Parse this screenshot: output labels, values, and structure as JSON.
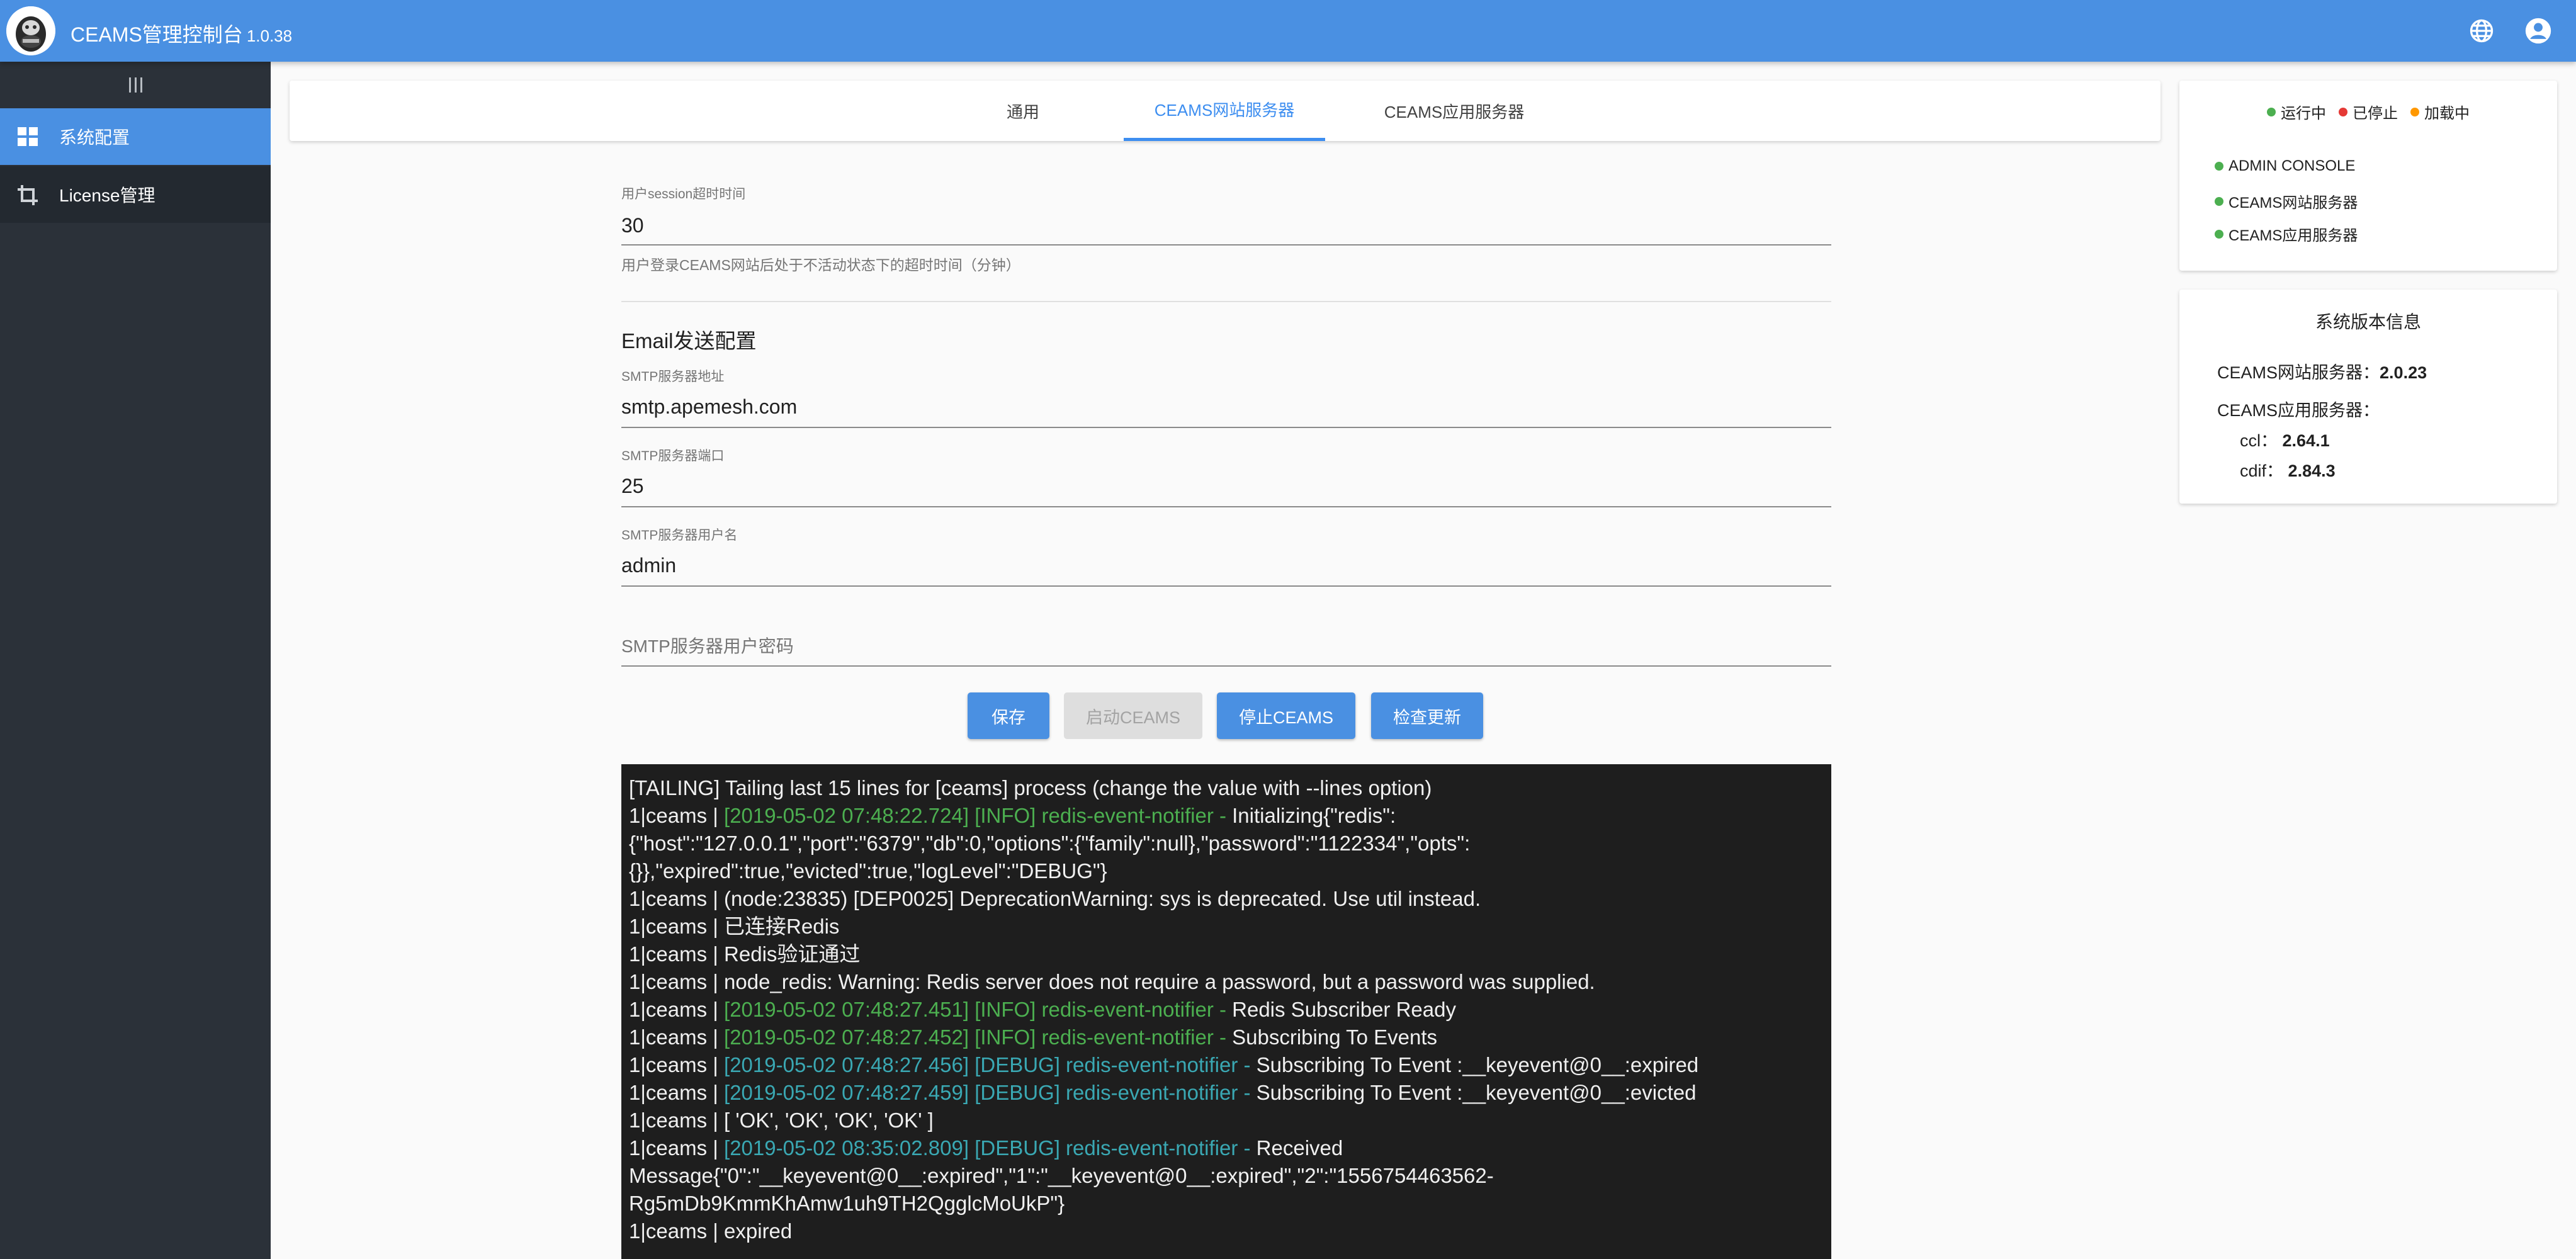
{
  "header": {
    "title": "CEAMS管理控制台",
    "version": "1.0.38",
    "icons": [
      "logo-avatar",
      "globe-icon",
      "account-icon"
    ]
  },
  "sidebar": {
    "toggle_icon": "menu-toggle-icon",
    "items": [
      {
        "label": "系统配置",
        "icon": "dashboard-icon",
        "active": true
      },
      {
        "label": "License管理",
        "icon": "crop-icon",
        "active": false
      }
    ]
  },
  "tabs": [
    {
      "label": "通用",
      "active": false
    },
    {
      "label": "CEAMS网站服务器",
      "active": true
    },
    {
      "label": "CEAMS应用服务器",
      "active": false
    }
  ],
  "form": {
    "session": {
      "label": "用户session超时时间",
      "value": "30",
      "hint": "用户登录CEAMS网站后处于不活动状态下的超时时间（分钟）"
    },
    "email_section_title": "Email发送配置",
    "smtp_host": {
      "label": "SMTP服务器地址",
      "value": "smtp.apemesh.com"
    },
    "smtp_port": {
      "label": "SMTP服务器端口",
      "value": "25"
    },
    "smtp_user": {
      "label": "SMTP服务器用户名",
      "value": "admin"
    },
    "smtp_password": {
      "placeholder": "SMTP服务器用户密码",
      "value": ""
    }
  },
  "buttons": {
    "save": "保存",
    "start": "启动CEAMS",
    "stop": "停止CEAMS",
    "check_update": "检查更新"
  },
  "console": {
    "lines": [
      {
        "parts": [
          {
            "t": "[TAILING] Tailing last 15 lines for [ceams] process (change the value with --lines option)",
            "c": ""
          }
        ]
      },
      {
        "parts": [
          {
            "t": "1|ceams | ",
            "c": ""
          },
          {
            "t": "[2019-05-02 07:48:22.724] [INFO] redis-event-notifier - ",
            "c": "info"
          },
          {
            "t": "Initializing{\"redis\":{\"host\":\"127.0.0.1\",\"port\":\"6379\",\"db\":0,\"options\":{\"family\":null},\"password\":\"1122334\",\"opts\":{}},\"expired\":true,\"evicted\":true,\"logLevel\":\"DEBUG\"}",
            "c": ""
          }
        ]
      },
      {
        "parts": [
          {
            "t": "1|ceams | (node:23835) [DEP0025] DeprecationWarning: sys is deprecated. Use util instead.",
            "c": ""
          }
        ]
      },
      {
        "parts": [
          {
            "t": "1|ceams | 已连接Redis",
            "c": ""
          }
        ]
      },
      {
        "parts": [
          {
            "t": "1|ceams | Redis验证通过",
            "c": ""
          }
        ]
      },
      {
        "parts": [
          {
            "t": "1|ceams | node_redis: Warning: Redis server does not require a password, but a password was supplied.",
            "c": ""
          }
        ]
      },
      {
        "parts": [
          {
            "t": "1|ceams | ",
            "c": ""
          },
          {
            "t": "[2019-05-02 07:48:27.451] [INFO] redis-event-notifier - ",
            "c": "info"
          },
          {
            "t": "Redis Subscriber Ready",
            "c": ""
          }
        ]
      },
      {
        "parts": [
          {
            "t": "1|ceams | ",
            "c": ""
          },
          {
            "t": "[2019-05-02 07:48:27.452] [INFO] redis-event-notifier - ",
            "c": "info"
          },
          {
            "t": "Subscribing To Events",
            "c": ""
          }
        ]
      },
      {
        "parts": [
          {
            "t": "1|ceams | ",
            "c": ""
          },
          {
            "t": "[2019-05-02 07:48:27.456] [DEBUG] redis-event-notifier - ",
            "c": "debug"
          },
          {
            "t": "Subscribing To Event :__keyevent@0__:expired",
            "c": ""
          }
        ]
      },
      {
        "parts": [
          {
            "t": "1|ceams | ",
            "c": ""
          },
          {
            "t": "[2019-05-02 07:48:27.459] [DEBUG] redis-event-notifier - ",
            "c": "debug"
          },
          {
            "t": "Subscribing To Event :__keyevent@0__:evicted",
            "c": ""
          }
        ]
      },
      {
        "parts": [
          {
            "t": "1|ceams | [ 'OK', 'OK', 'OK', 'OK' ]",
            "c": ""
          }
        ]
      },
      {
        "parts": [
          {
            "t": "1|ceams | ",
            "c": ""
          },
          {
            "t": "[2019-05-02 08:35:02.809] [DEBUG] redis-event-notifier - ",
            "c": "debug"
          },
          {
            "t": "Received Message{\"0\":\"__keyevent@0__:expired\",\"1\":\"__keyevent@0__:expired\",\"2\":\"1556754463562-Rg5mDb9KmmKhAmw1uh9TH2QgglcMoUkP\"}",
            "c": ""
          }
        ]
      },
      {
        "parts": [
          {
            "t": "1|ceams | expired",
            "c": ""
          }
        ]
      }
    ],
    "colors": {
      "info": "#4caf50",
      "debug": "#3aa8b3",
      "text": "#f0f0f0",
      "background": "#1e1e1e"
    }
  },
  "status_panel": {
    "legend": [
      {
        "label": "运行中",
        "color": "#4caf50"
      },
      {
        "label": "已停止",
        "color": "#e53935"
      },
      {
        "label": "加载中",
        "color": "#ff9800"
      }
    ],
    "services": [
      {
        "name": "ADMIN CONSOLE",
        "status_color": "#4caf50"
      },
      {
        "name": "CEAMS网站服务器",
        "status_color": "#4caf50"
      },
      {
        "name": "CEAMS应用服务器",
        "status_color": "#4caf50"
      }
    ]
  },
  "version_panel": {
    "title": "系统版本信息",
    "web_label": "CEAMS网站服务器：",
    "web_version": "2.0.23",
    "app_label": "CEAMS应用服务器：",
    "ccl_label": "ccl：",
    "ccl_version": "2.64.1",
    "cdif_label": "cdif：",
    "cdif_version": "2.84.3"
  },
  "colors": {
    "primary": "#4a90e2",
    "sidebar_bg": "#2b3139",
    "tab_active": "#3d8ef0"
  }
}
